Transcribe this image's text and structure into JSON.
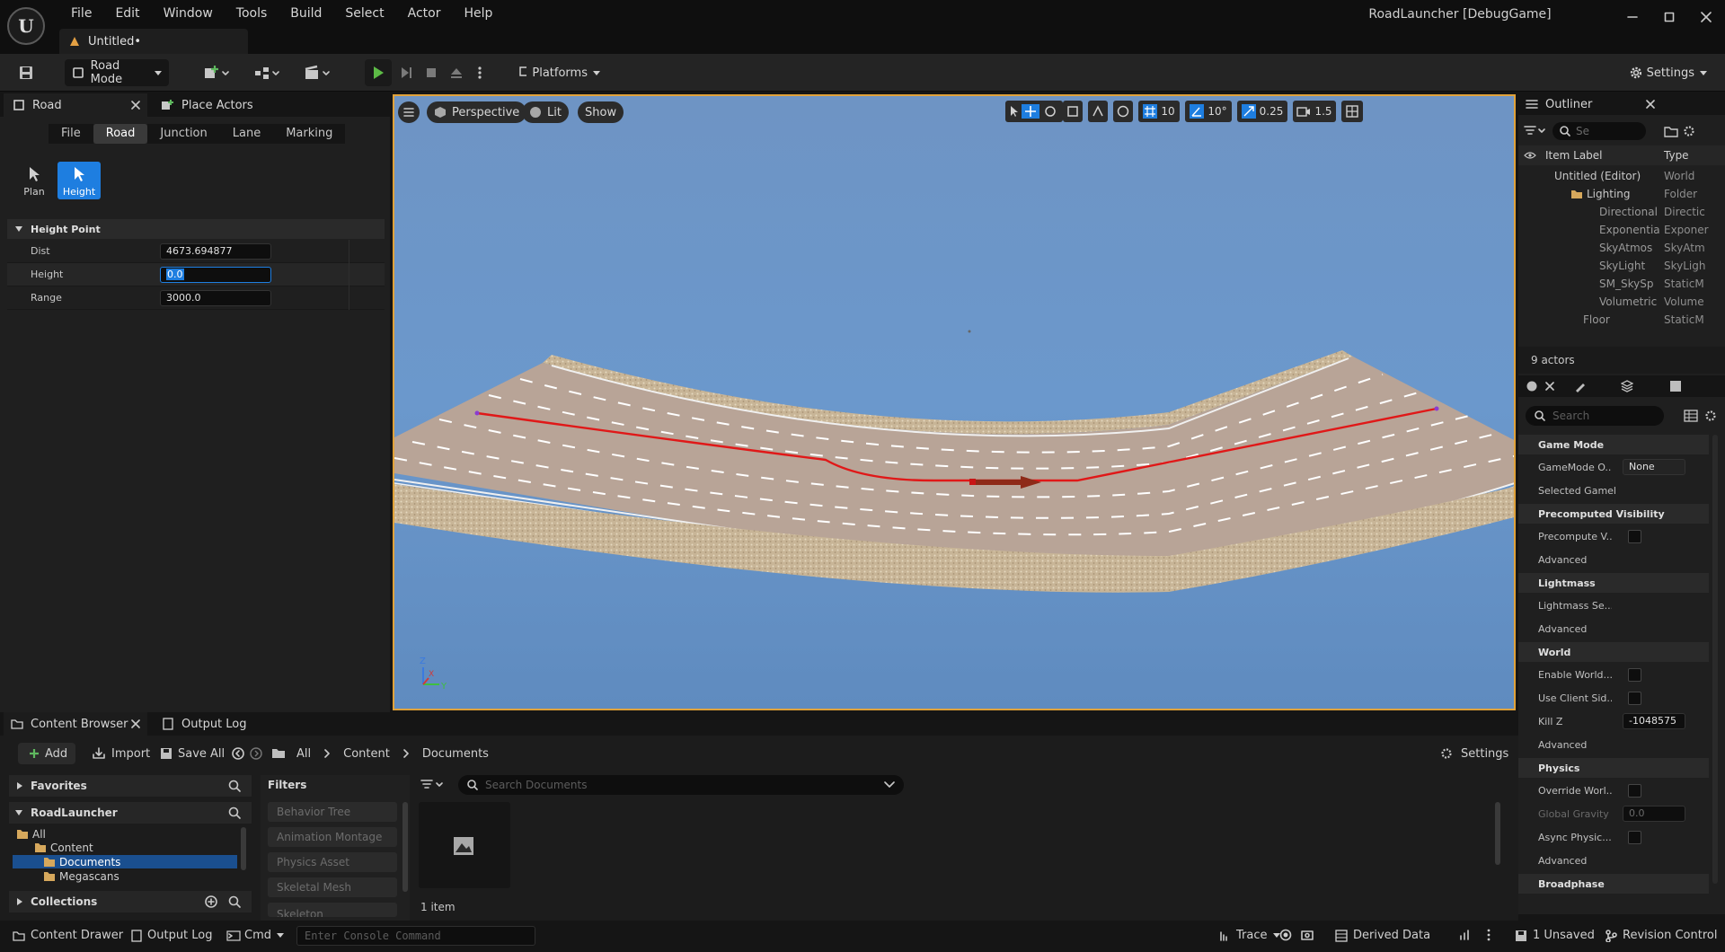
{
  "app": {
    "window_title": "RoadLauncher [DebugGame]",
    "document_tab": "Untitled•",
    "menu": [
      "File",
      "Edit",
      "Window",
      "Tools",
      "Build",
      "Select",
      "Actor",
      "Help"
    ]
  },
  "toolbar": {
    "mode_dropdown": "Road Mode",
    "platforms": "Platforms",
    "settings": "Settings"
  },
  "left_panel": {
    "tabs": [
      "Road",
      "Place Actors"
    ],
    "subtabs": [
      "File",
      "Road",
      "Junction",
      "Lane",
      "Marking"
    ],
    "active_subtab": "Road",
    "modes": [
      {
        "label": "Plan",
        "active": false
      },
      {
        "label": "Height",
        "active": true
      }
    ],
    "section": "Height Point",
    "properties": [
      {
        "label": "Dist",
        "value": "4673.694877"
      },
      {
        "label": "Height",
        "value": "0.0"
      },
      {
        "label": "Range",
        "value": "3000.0"
      }
    ]
  },
  "viewport": {
    "view_mode": "Perspective",
    "lighting": "Lit",
    "show": "Show",
    "grid_snap": "10",
    "rotation_snap": "10°",
    "scale_snap": "0.25",
    "camera_speed": "1.5",
    "axis_z": "Z",
    "axis_x": "X",
    "axis_y": "Y"
  },
  "outliner": {
    "title": "Outliner",
    "search_placeholder": "Se",
    "col_label": "Item Label",
    "col_type": "Type",
    "items": [
      {
        "label": "Untitled (Editor)",
        "type": "World"
      },
      {
        "label": "Lighting",
        "type": "Folder"
      },
      {
        "label": "Directional",
        "type": "Directic"
      },
      {
        "label": "Exponentia",
        "type": "Exponer"
      },
      {
        "label": "SkyAtmos",
        "type": "SkyAtm"
      },
      {
        "label": "SkyLight",
        "type": "SkyLigh"
      },
      {
        "label": "SM_SkySp",
        "type": "StaticM"
      },
      {
        "label": "Volumetric",
        "type": "Volume"
      },
      {
        "label": "Floor",
        "type": "StaticM"
      }
    ],
    "actor_count": "9 actors"
  },
  "details": {
    "search_placeholder": "Search",
    "sections": {
      "game_mode": "Game Mode",
      "gamemode_override_label": "GameMode O...",
      "gamemode_override_value": "None",
      "selected_gamemode": "Selected Gamel",
      "precomputed_visibility": "Precomputed Visibility",
      "precompute_v": "Precompute V...",
      "advanced": "Advanced",
      "lightmass": "Lightmass",
      "lightmass_se": "Lightmass Se...",
      "world": "World",
      "enable_world": "Enable World...",
      "use_client_side": "Use Client Sid...",
      "kill_z": "Kill Z",
      "kill_z_value": "-1048575",
      "physics": "Physics",
      "override_world": "Override Worl...",
      "global_gravity": "Global Gravity Z",
      "global_gravity_value": "0.0",
      "async_physics": "Async Physic...",
      "broadphase": "Broadphase"
    }
  },
  "content_browser": {
    "tabs": [
      "Content Browser",
      "Output Log"
    ],
    "add": "Add",
    "import": "Import",
    "save_all": "Save All",
    "breadcrumb": [
      "All",
      "Content",
      "Documents"
    ],
    "settings": "Settings",
    "favorites": "Favorites",
    "project": "RoadLauncher",
    "tree": [
      "All",
      "Content",
      "Documents",
      "Megascans"
    ],
    "collections": "Collections",
    "filters_title": "Filters",
    "filters": [
      "Behavior Tree",
      "Animation Montage",
      "Physics Asset",
      "Skeletal Mesh",
      "Skeleton"
    ],
    "search_placeholder": "Search Documents",
    "item_count": "1 item"
  },
  "status_bar": {
    "content_drawer": "Content Drawer",
    "output_log": "Output Log",
    "cmd": "Cmd",
    "console_placeholder": "Enter Console Command",
    "trace": "Trace",
    "derived_data": "Derived Data",
    "unsaved": "1 Unsaved",
    "revision_control": "Revision Control"
  }
}
